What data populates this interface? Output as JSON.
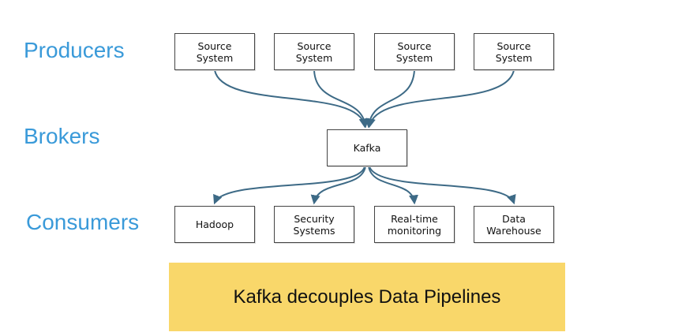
{
  "colors": {
    "tier_label": "#3a9ad9",
    "connector": "#3d6a86",
    "banner_fill": "#f9d76a"
  },
  "tiers": {
    "producers": "Producers",
    "brokers": "Brokers",
    "consumers": "Consumers"
  },
  "producers": [
    {
      "label": "Source\nSystem"
    },
    {
      "label": "Source\nSystem"
    },
    {
      "label": "Source\nSystem"
    },
    {
      "label": "Source\nSystem"
    }
  ],
  "broker": {
    "label": "Kafka"
  },
  "consumers": [
    {
      "label": "Hadoop"
    },
    {
      "label": "Security\nSystems"
    },
    {
      "label": "Real-time\nmonitoring"
    },
    {
      "label": "Data\nWarehouse"
    }
  ],
  "banner": {
    "text": "Kafka decouples Data Pipelines"
  }
}
